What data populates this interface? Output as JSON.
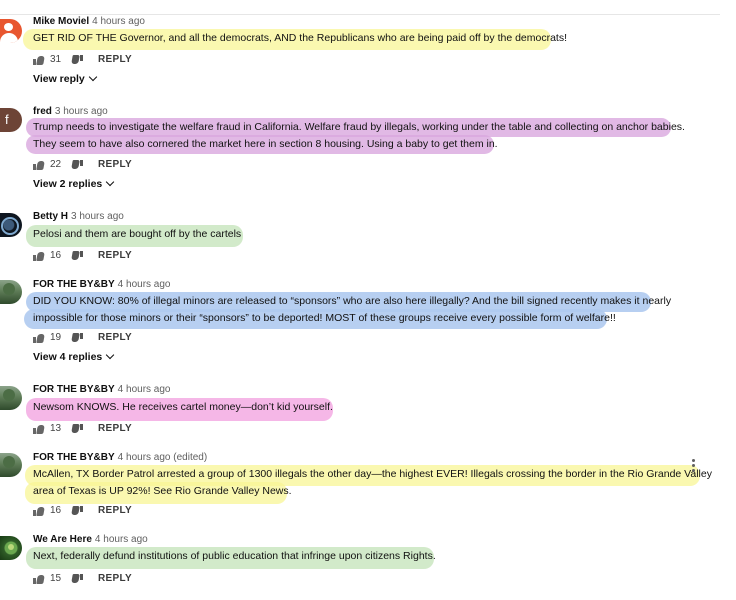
{
  "comments": [
    {
      "author": "Mike Moviel",
      "time": "4 hours ago",
      "avatar": "person-avatar-icon",
      "lines": [
        "GET RID OF THE Governor, and all the democrats, AND the Republicans who are being paid off by the democrats!"
      ],
      "likes": "31",
      "reply_label": "REPLY",
      "view_replies": "View reply",
      "highlight": "#f8f696"
    },
    {
      "author": "fred",
      "time": "3 hours ago",
      "avatar_letter": "f",
      "lines": [
        "Trump needs to investigate the welfare fraud in California.   Welfare fraud by illegals, working under the table and collecting on anchor babies.",
        "They seem to have also cornered the market here in section 8 housing.   Using a baby to get them in."
      ],
      "likes": "22",
      "reply_label": "REPLY",
      "view_replies": "View 2 replies",
      "highlight": "#daa8de"
    },
    {
      "author": "Betty H",
      "time": "3 hours ago",
      "avatar": "badge-avatar-icon",
      "lines": [
        "Pelosi and them are bought off by the cartels"
      ],
      "likes": "16",
      "reply_label": "REPLY",
      "highlight": "#cde8c4"
    },
    {
      "author": "FOR THE BY&BY",
      "time": "4 hours ago",
      "avatar": "landscape-avatar-icon",
      "lines": [
        "DID YOU KNOW: 80% of illegal minors are released to “sponsors” who are also here illegally?  And the bill signed recently makes it nearly",
        "impossible for those minors or their “sponsors” to be deported!  MOST of these groups receive every possible form of welfare!!"
      ],
      "likes": "19",
      "reply_label": "REPLY",
      "view_replies": "View 4 replies",
      "highlight": "#afcaf0"
    },
    {
      "author": "FOR THE BY&BY",
      "time": "4 hours ago",
      "avatar": "landscape-avatar-icon",
      "lines": [
        "Newsom KNOWS.  He receives cartel money—don’t kid yourself."
      ],
      "likes": "13",
      "reply_label": "REPLY",
      "highlight": "#f3aae3"
    },
    {
      "author": "FOR THE BY&BY",
      "time": "4 hours ago (edited)",
      "avatar": "landscape-avatar-icon",
      "lines": [
        "McAllen, TX Border Patrol arrested a group of 1300 illegals the other day—the highest EVER!  Illegals crossing the border in the Rio Grande Valley",
        "area of Texas is UP 92%!  See Rio Grande Valley News."
      ],
      "likes": "16",
      "reply_label": "REPLY",
      "highlight": "#f8f696"
    },
    {
      "author": "We Are Here",
      "time": "4 hours ago",
      "avatar": "alien-avatar-icon",
      "lines": [
        "Next, federally defund institutions of public education that infringe upon citizens Rights."
      ],
      "likes": "15",
      "reply_label": "REPLY",
      "highlight": "#cde8c4"
    }
  ]
}
